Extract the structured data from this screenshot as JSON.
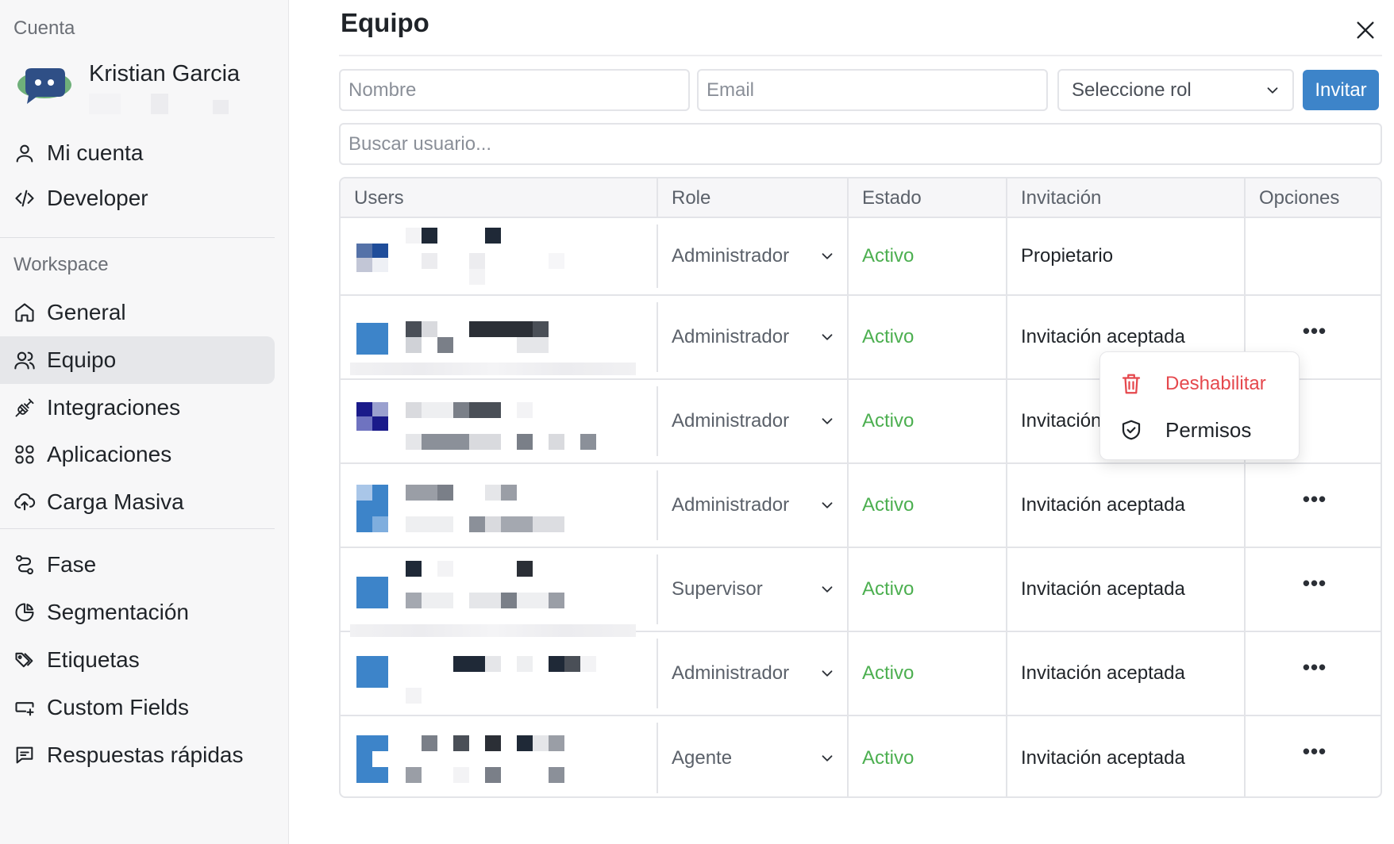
{
  "sidebar": {
    "account_title": "Cuenta",
    "profile": {
      "name": "Kristian Garcia"
    },
    "account_items": [
      {
        "label": "Mi cuenta",
        "icon": "user-icon"
      },
      {
        "label": "Developer",
        "icon": "code-icon"
      }
    ],
    "workspace_title": "Workspace",
    "workspace_items": [
      {
        "label": "General",
        "icon": "home-icon"
      },
      {
        "label": "Equipo",
        "icon": "users-icon",
        "active": true
      },
      {
        "label": "Integraciones",
        "icon": "plug-icon"
      },
      {
        "label": "Aplicaciones",
        "icon": "grid-icon"
      },
      {
        "label": "Carga Masiva",
        "icon": "cloud-upload-icon"
      }
    ],
    "other_items": [
      {
        "label": "Fase",
        "icon": "route-icon"
      },
      {
        "label": "Segmentación",
        "icon": "pie-chart-icon"
      },
      {
        "label": "Etiquetas",
        "icon": "tags-icon"
      },
      {
        "label": "Custom Fields",
        "icon": "input-plus-icon"
      },
      {
        "label": "Respuestas rápidas",
        "icon": "message-icon"
      }
    ]
  },
  "main": {
    "title": "Equipo",
    "invite_form": {
      "name_placeholder": "Nombre",
      "email_placeholder": "Email",
      "role_select": "Seleccione rol",
      "invite_label": "Invitar"
    },
    "search_placeholder": "Buscar usuario...",
    "table": {
      "columns": [
        "Users",
        "Role",
        "Estado",
        "Invitación",
        "Opciones"
      ],
      "rows": [
        {
          "role": "Administrador",
          "status": "Activo",
          "invitation": "Propietario",
          "has_options": false
        },
        {
          "role": "Administrador",
          "status": "Activo",
          "invitation": "Invitación aceptada",
          "has_options": true
        },
        {
          "role": "Administrador",
          "status": "Activo",
          "invitation": "Invitación a",
          "has_options": false
        },
        {
          "role": "Administrador",
          "status": "Activo",
          "invitation": "Invitación aceptada",
          "has_options": true
        },
        {
          "role": "Supervisor",
          "status": "Activo",
          "invitation": "Invitación aceptada",
          "has_options": true
        },
        {
          "role": "Administrador",
          "status": "Activo",
          "invitation": "Invitación aceptada",
          "has_options": true
        },
        {
          "role": "Agente",
          "status": "Activo",
          "invitation": "Invitación aceptada",
          "has_options": true
        }
      ],
      "options_glyph": "•••"
    },
    "options_menu": {
      "items": [
        {
          "label": "Deshabilitar",
          "icon": "trash-icon",
          "color": "#e5484d"
        },
        {
          "label": "Permisos",
          "icon": "shield-check-icon",
          "color": "#1f2328"
        }
      ]
    }
  },
  "colors": {
    "accent": "#3d84c9",
    "status_active": "#4caf50",
    "danger": "#e5484d",
    "sidebar_bg": "#f7f7f8",
    "active_nav_bg": "#e6e7ea"
  }
}
